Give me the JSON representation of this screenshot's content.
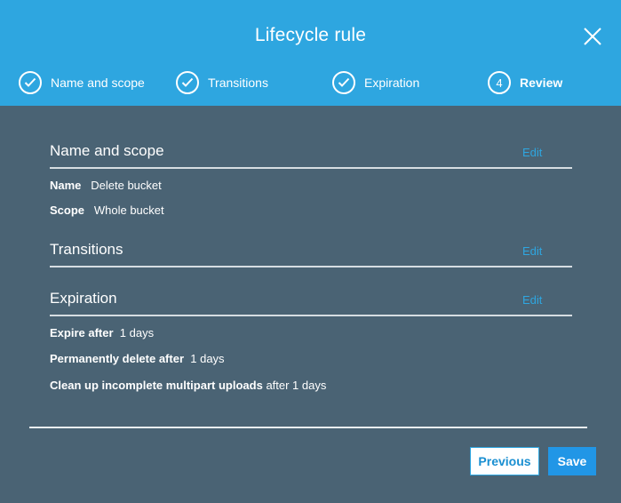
{
  "dialog": {
    "title": "Lifecycle rule",
    "close_icon": "close-icon"
  },
  "steps": [
    {
      "label": "Name and scope",
      "state": "completed",
      "icon": "check-circle-icon"
    },
    {
      "label": "Transitions",
      "state": "completed",
      "icon": "check-circle-icon"
    },
    {
      "label": "Expiration",
      "state": "completed",
      "icon": "check-circle-icon"
    },
    {
      "number": "4",
      "label": "Review",
      "state": "active"
    }
  ],
  "sections": {
    "name_scope": {
      "title": "Name and scope",
      "edit_label": "Edit",
      "fields": [
        {
          "key": "Name",
          "value": "Delete bucket"
        },
        {
          "key": "Scope",
          "value": "Whole bucket"
        }
      ]
    },
    "transitions": {
      "title": "Transitions",
      "edit_label": "Edit"
    },
    "expiration": {
      "title": "Expiration",
      "edit_label": "Edit",
      "fields": [
        {
          "key": "Expire after",
          "value": "1 days"
        },
        {
          "key": "Permanently delete after",
          "value": "1 days"
        },
        {
          "key": "Clean up incomplete multipart uploads",
          "value": "after 1 days"
        }
      ]
    }
  },
  "footer": {
    "previous_label": "Previous",
    "save_label": "Save"
  },
  "colors": {
    "header_bg": "#2ea6e0",
    "body_bg": "#4a6374",
    "link": "#2ea6e0",
    "primary_button": "#2196e6"
  }
}
